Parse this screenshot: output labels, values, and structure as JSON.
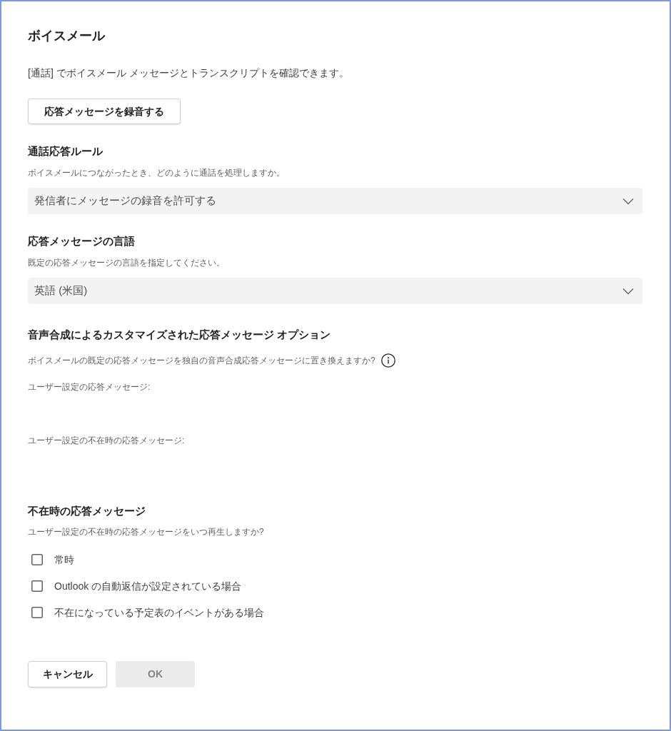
{
  "dialog": {
    "title": "ボイスメール",
    "description": "[通話] でボイスメール メッセージとトランスクリプトを確認できます。",
    "record_button": "応答メッセージを録音する"
  },
  "sections": [
    {
      "kind": "dropdown",
      "heading": "通話応答ルール",
      "subtitle": "ボイスメールにつながったとき、どのように通話を処理しますか。",
      "value": "発信者にメッセージの録音を許可する"
    },
    {
      "kind": "dropdown",
      "heading": "応答メッセージの言語",
      "subtitle": "既定の応答メッセージの言語を指定してください。",
      "value": "英語 (米国)"
    },
    {
      "kind": "greetings",
      "heading": "音声合成によるカスタマイズされた応答メッセージ オプション",
      "subtitle": "ボイスメールの既定の応答メッセージを独自の音声合成応答メッセージに置き換えますか?",
      "labels": [
        "ユーザー設定の応答メッセージ:",
        "ユーザー設定の不在時の応答メッセージ:"
      ]
    },
    {
      "kind": "checkboxes",
      "heading": "不在時の応答メッセージ",
      "subtitle": "ユーザー設定の不在時の応答メッセージをいつ再生しますか?",
      "options": [
        {
          "label": "常時",
          "checked": false
        },
        {
          "label": "Outlook の自動返信が設定されている場合",
          "checked": false
        },
        {
          "label": "不在になっている予定表のイベントがある場合",
          "checked": false
        }
      ]
    }
  ],
  "buttons": [
    {
      "label": "キャンセル",
      "disabled": false
    },
    {
      "label": "OK",
      "disabled": true
    }
  ]
}
